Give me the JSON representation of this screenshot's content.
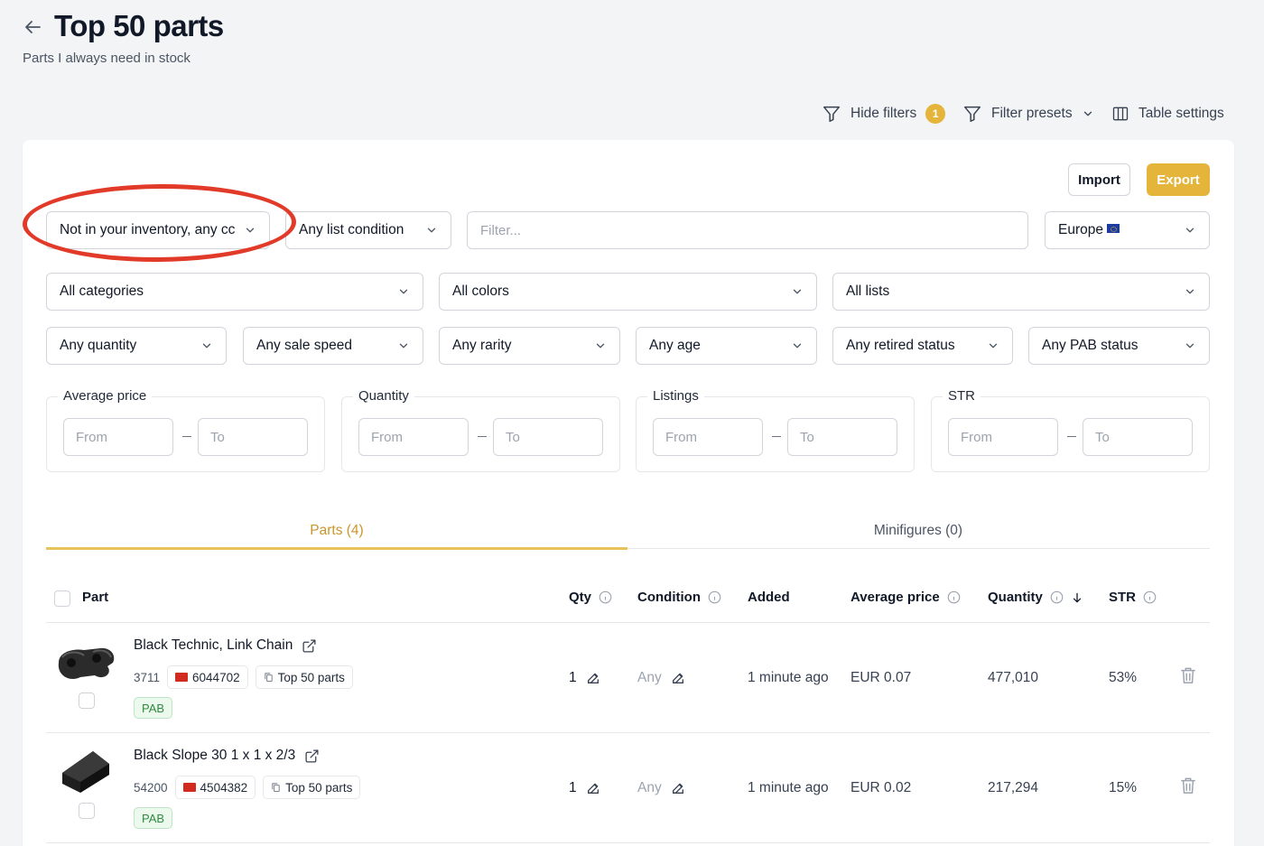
{
  "header": {
    "title": "Top 50 parts",
    "subtitle": "Parts I always need in stock"
  },
  "toolbar": {
    "hide_filters": "Hide filters",
    "hide_filters_count": "1",
    "filter_presets": "Filter presets",
    "table_settings": "Table settings"
  },
  "actions": {
    "import": "Import",
    "export": "Export"
  },
  "filters": {
    "inventory": "Not in your inventory, any cc",
    "list_condition": "Any list condition",
    "search_placeholder": "Filter...",
    "region": "Europe",
    "categories": "All categories",
    "colors": "All colors",
    "lists": "All lists",
    "quantity": "Any quantity",
    "sale_speed": "Any sale speed",
    "rarity": "Any rarity",
    "age": "Any age",
    "retired_status": "Any retired status",
    "pab_status": "Any PAB status"
  },
  "ranges": [
    {
      "label": "Average price",
      "from": "From",
      "to": "To"
    },
    {
      "label": "Quantity",
      "from": "From",
      "to": "To"
    },
    {
      "label": "Listings",
      "from": "From",
      "to": "To"
    },
    {
      "label": "STR",
      "from": "From",
      "to": "To"
    }
  ],
  "tabs": [
    {
      "label": "Parts (4)",
      "active": true
    },
    {
      "label": "Minifigures (0)",
      "active": false
    }
  ],
  "table": {
    "columns": {
      "part": "Part",
      "qty": "Qty",
      "condition": "Condition",
      "added": "Added",
      "average_price": "Average price",
      "quantity": "Quantity",
      "str": "STR"
    },
    "rows": [
      {
        "name": "Black Technic, Link Chain",
        "part_no": "3711",
        "element_id": "6044702",
        "list": "Top 50 parts",
        "badge": "PAB",
        "qty": "1",
        "condition": "Any",
        "added": "1 minute ago",
        "avg_price": "EUR 0.07",
        "quantity": "477,010",
        "str": "53%"
      },
      {
        "name": "Black Slope 30 1 x 1 x 2/3",
        "part_no": "54200",
        "element_id": "4504382",
        "list": "Top 50 parts",
        "badge": "PAB",
        "qty": "1",
        "condition": "Any",
        "added": "1 minute ago",
        "avg_price": "EUR 0.02",
        "quantity": "217,294",
        "str": "15%"
      }
    ]
  },
  "colors": {
    "accent": "#e4b53a",
    "tab_active": "#c9962a",
    "highlight": "#e23a29",
    "pab_green": "#2f8a3e"
  }
}
